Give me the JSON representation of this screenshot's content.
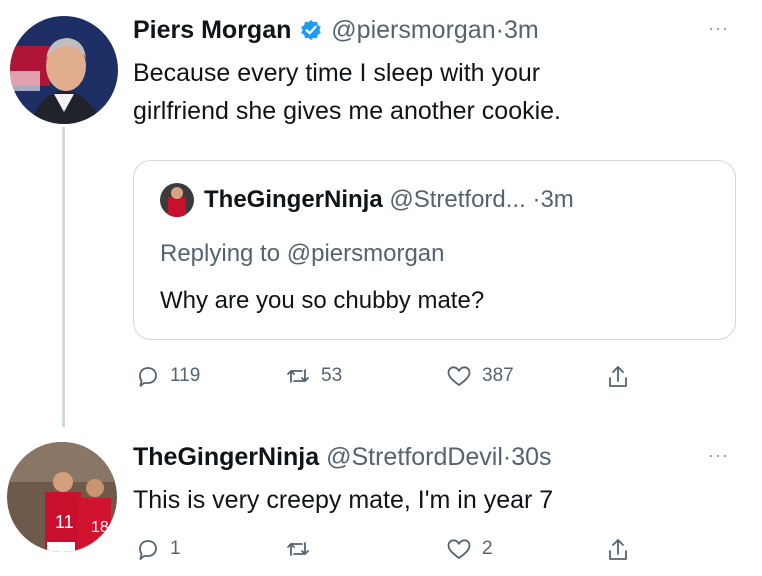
{
  "tweet1": {
    "name": "Piers Morgan",
    "handle": "@piersmorgan",
    "time": "3m",
    "text_line1": "Because every time I sleep with your",
    "text_line2": "girlfriend she gives me another cookie.",
    "more": "···",
    "quote": {
      "name": "TheGingerNinja",
      "handle": "@Stretford...",
      "time": "3m",
      "replying": "Replying to @piersmorgan",
      "text": "Why are you so chubby mate?"
    },
    "actions": {
      "replies": "119",
      "retweets": "53",
      "likes": "387"
    }
  },
  "tweet2": {
    "name": "TheGingerNinja",
    "handle": "@StretfordDevil",
    "time": "30s",
    "text": "This is very creepy mate, I'm in year 7",
    "more": "···",
    "actions": {
      "replies": "1",
      "retweets": "",
      "likes": "2"
    }
  },
  "separator": "·",
  "icons": [
    "verified-badge-icon",
    "reply-icon",
    "retweet-icon",
    "like-icon",
    "share-icon",
    "more-icon"
  ],
  "colors": {
    "verified": "#1d9bf0",
    "text": "#0f1419",
    "muted": "#536471",
    "border": "#cfd9de"
  }
}
